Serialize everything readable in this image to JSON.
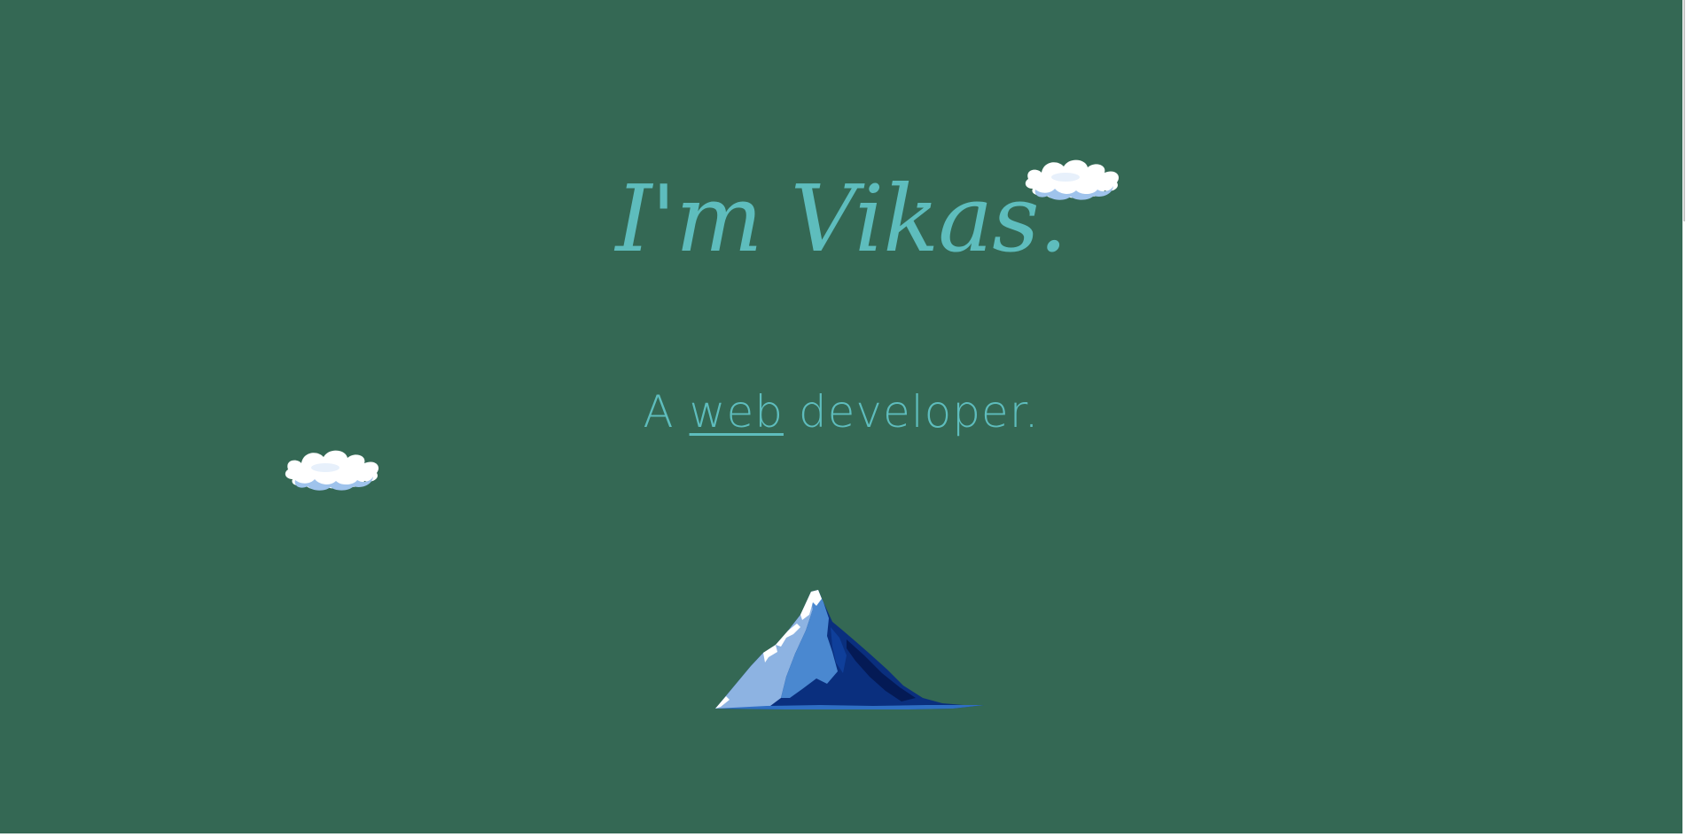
{
  "hero": {
    "background_color": "#346854",
    "accent_color": "#5ebdbd",
    "headline": "I'm Vikas.",
    "tagline": {
      "prefix": "A",
      "link_text": "web",
      "suffix": "developer."
    }
  },
  "decorations": {
    "clouds": [
      "cloud-illustration",
      "cloud-illustration"
    ],
    "mountain": "snow-capped-mountain-illustration"
  }
}
